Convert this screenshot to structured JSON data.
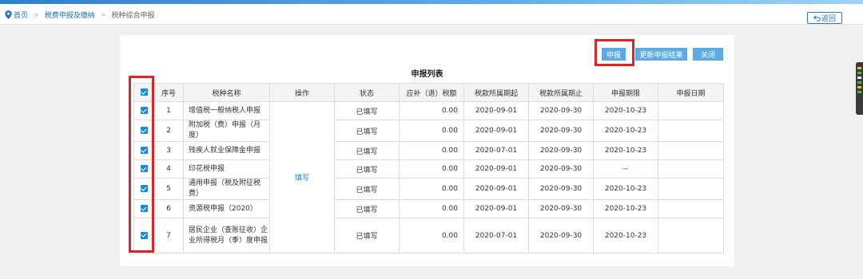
{
  "breadcrumb": {
    "home": "首页",
    "level2": "税费申报及缴纳",
    "current": "税种综合申报"
  },
  "header": {
    "back_label": "返回"
  },
  "toolbar": {
    "submit_label": "申报",
    "refresh_label": "更新申报结果",
    "close_label": "关闭"
  },
  "list": {
    "title": "申报列表",
    "columns": [
      "序号",
      "税种名称",
      "操作",
      "状态",
      "应补（退）税额",
      "税款所属期起",
      "税款所属期止",
      "申报期限",
      "申报日期"
    ],
    "operation_label": "填写",
    "rows": [
      {
        "seq": "1",
        "name": "增值税一般纳税人申报",
        "status": "已填写",
        "amount": "0.00",
        "start": "2020-09-01",
        "end": "2020-09-30",
        "deadline": "2020-10-23",
        "date": ""
      },
      {
        "seq": "2",
        "name": "附加税（费）申报（月度）",
        "status": "已填写",
        "amount": "0.00",
        "start": "2020-09-01",
        "end": "2020-09-30",
        "deadline": "2020-10-23",
        "date": ""
      },
      {
        "seq": "3",
        "name": "残疾人就业保障金申报",
        "status": "已填写",
        "amount": "0.00",
        "start": "2020-07-01",
        "end": "2020-09-30",
        "deadline": "2020-10-23",
        "date": ""
      },
      {
        "seq": "4",
        "name": "印花税申报",
        "status": "已填写",
        "amount": "0.00",
        "start": "2020-09-01",
        "end": "2020-09-30",
        "deadline": "--",
        "date": ""
      },
      {
        "seq": "5",
        "name": "通用申报（税及附征税费）",
        "status": "已填写",
        "amount": "0.00",
        "start": "2020-09-01",
        "end": "2020-09-30",
        "deadline": "2020-10-23",
        "date": ""
      },
      {
        "seq": "6",
        "name": "资源税申报（2020）",
        "status": "已填写",
        "amount": "0.00",
        "start": "2020-09-01",
        "end": "2020-09-30",
        "deadline": "2020-10-23",
        "date": ""
      },
      {
        "seq": "7",
        "name": "居民企业（查账征收）企业所得税月（季）度申报",
        "status": "已填写",
        "amount": "0.00",
        "start": "2020-07-01",
        "end": "2020-09-30",
        "deadline": "2020-10-23",
        "date": ""
      }
    ]
  },
  "colors": {
    "accent": "#1e88d8",
    "button": "#5eaae4",
    "highlight": "#e02424"
  }
}
